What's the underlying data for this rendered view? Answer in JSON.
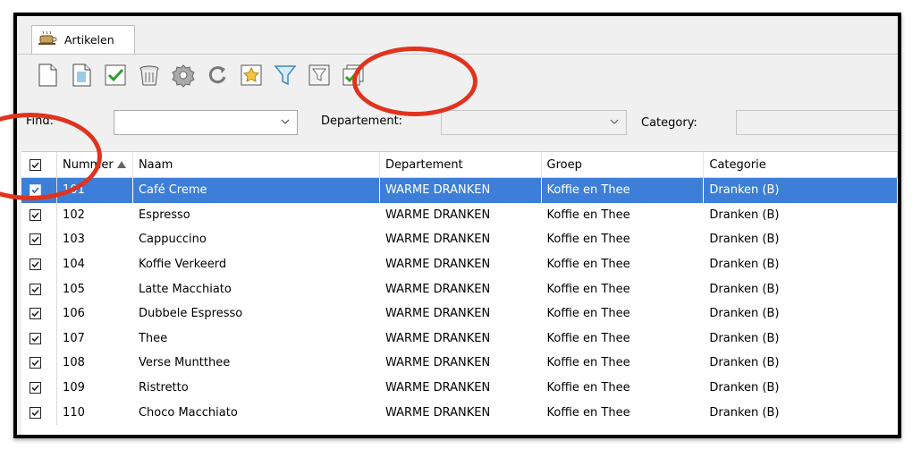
{
  "tab": {
    "label": "Artikelen"
  },
  "toolbar": {
    "buttons": [
      "new-document-icon",
      "edit-document-icon",
      "checkmark-icon",
      "delete-bin-icon",
      "gear-icon",
      "refresh-icon",
      "favorite-star-icon",
      "filter-icon",
      "clear-filter-icon",
      "select-all-icon"
    ]
  },
  "filters": {
    "find_label": "Find:",
    "find_value": "",
    "departement_label": "Departement:",
    "departement_value": "",
    "category_label": "Category:",
    "category_value": ""
  },
  "grid": {
    "columns": [
      "Nummer",
      "Naam",
      "Departement",
      "Groep",
      "Categorie"
    ],
    "rows": [
      {
        "nummer": "101",
        "naam": "Café Creme",
        "departement": "WARME DRANKEN",
        "groep": "Koffie en Thee",
        "categorie": "Dranken (B)",
        "checked": true,
        "selected": true
      },
      {
        "nummer": "102",
        "naam": "Espresso",
        "departement": "WARME DRANKEN",
        "groep": "Koffie en Thee",
        "categorie": "Dranken (B)",
        "checked": true,
        "selected": false
      },
      {
        "nummer": "103",
        "naam": "Cappuccino",
        "departement": "WARME DRANKEN",
        "groep": "Koffie en Thee",
        "categorie": "Dranken (B)",
        "checked": true,
        "selected": false
      },
      {
        "nummer": "104",
        "naam": "Koffie Verkeerd",
        "departement": "WARME DRANKEN",
        "groep": "Koffie en Thee",
        "categorie": "Dranken (B)",
        "checked": true,
        "selected": false
      },
      {
        "nummer": "105",
        "naam": "Latte Macchiato",
        "departement": "WARME DRANKEN",
        "groep": "Koffie en Thee",
        "categorie": "Dranken (B)",
        "checked": true,
        "selected": false
      },
      {
        "nummer": "106",
        "naam": "Dubbele Espresso",
        "departement": "WARME DRANKEN",
        "groep": "Koffie en Thee",
        "categorie": "Dranken (B)",
        "checked": true,
        "selected": false
      },
      {
        "nummer": "107",
        "naam": "Thee",
        "departement": "WARME DRANKEN",
        "groep": "Koffie en Thee",
        "categorie": "Dranken (B)",
        "checked": true,
        "selected": false
      },
      {
        "nummer": "108",
        "naam": "Verse Muntthee",
        "departement": "WARME DRANKEN",
        "groep": "Koffie en Thee",
        "categorie": "Dranken (B)",
        "checked": true,
        "selected": false
      },
      {
        "nummer": "109",
        "naam": "Ristretto",
        "departement": "WARME DRANKEN",
        "groep": "Koffie en Thee",
        "categorie": "Dranken (B)",
        "checked": true,
        "selected": false
      },
      {
        "nummer": "110",
        "naam": "Choco Macchiato",
        "departement": "WARME DRANKEN",
        "groep": "Koffie en Thee",
        "categorie": "Dranken (B)",
        "checked": true,
        "selected": false
      }
    ]
  },
  "colors": {
    "selection": "#3d7fd8",
    "annotation": "#e0331e",
    "check": "#2e9e2e"
  }
}
